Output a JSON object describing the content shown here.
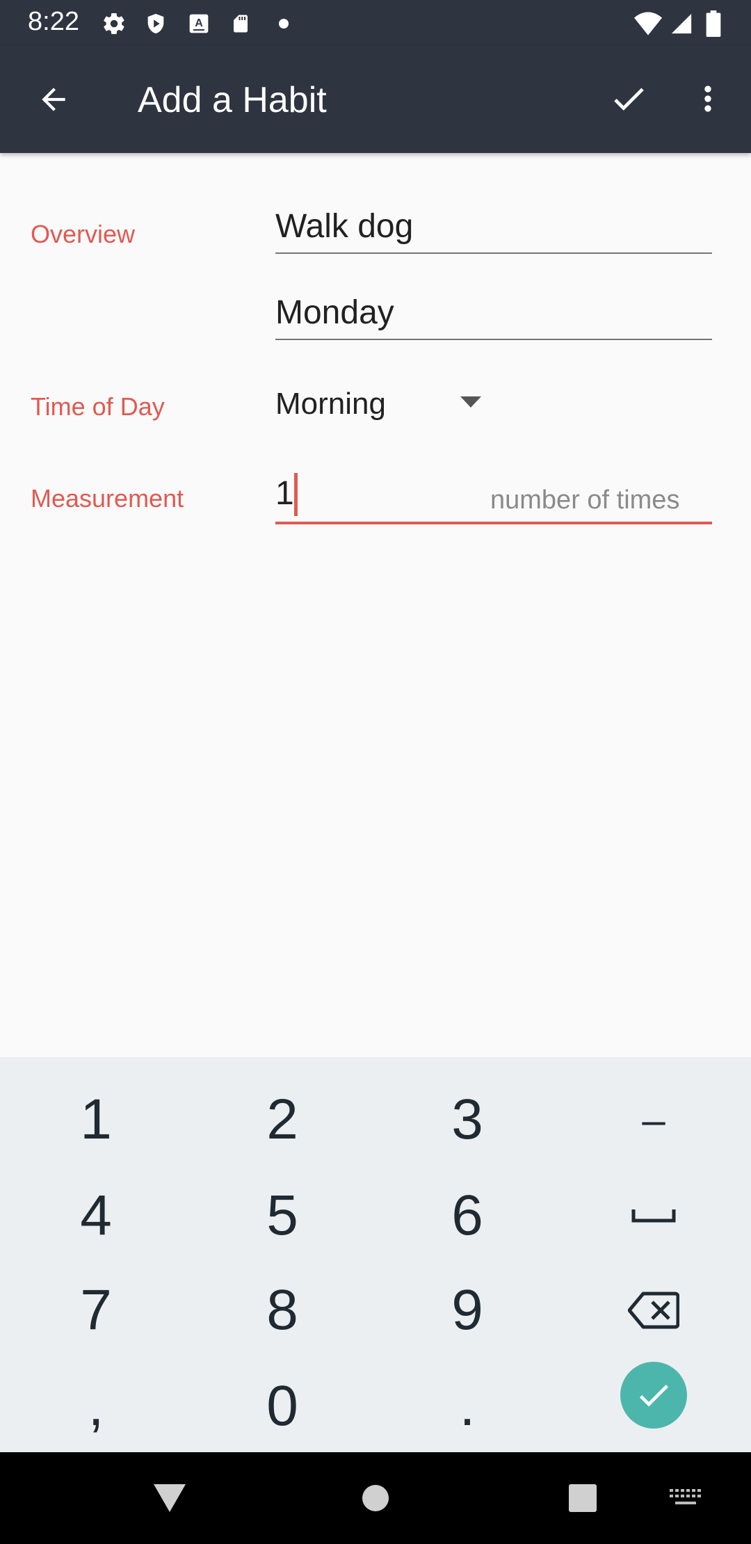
{
  "status_bar": {
    "time": "8:22",
    "icons": [
      "gear-icon",
      "shield-icon",
      "a-icon",
      "sd-card-icon",
      "dot-icon",
      "wifi-icon",
      "signal-icon",
      "battery-icon"
    ]
  },
  "app_bar": {
    "title": "Add a Habit",
    "back_icon": "arrow-back-icon",
    "save_icon": "check-icon",
    "more_icon": "more-vert-icon"
  },
  "form": {
    "overview_label": "Overview",
    "name_value": "Walk dog",
    "day_value": "Monday",
    "time_of_day_label": "Time of Day",
    "time_of_day_value": "Morning",
    "measurement_label": "Measurement",
    "measurement_value": "1",
    "measurement_unit": "number of times"
  },
  "keyboard": {
    "rows": [
      [
        "1",
        "2",
        "3",
        "–"
      ],
      [
        "4",
        "5",
        "6",
        "␣"
      ],
      [
        "7",
        "8",
        "9",
        "⌫"
      ],
      [
        ",",
        "0",
        ".",
        "✓"
      ]
    ],
    "accent_color": "#4db6ac"
  },
  "colors": {
    "app_bar": "#2e3440",
    "label": "#e05a52",
    "background": "#fafafa"
  }
}
